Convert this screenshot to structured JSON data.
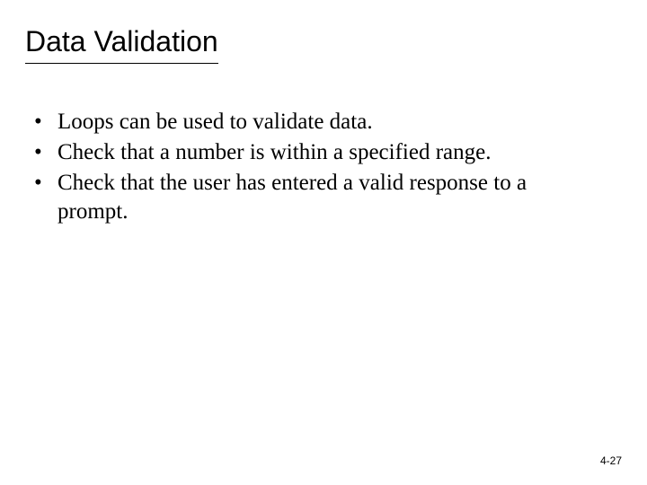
{
  "title": "Data Validation",
  "bullets": [
    "Loops can be used to validate data.",
    "Check that a number is within a specified range.",
    "Check that the user has entered a valid response to a prompt."
  ],
  "page_number": "4-27"
}
